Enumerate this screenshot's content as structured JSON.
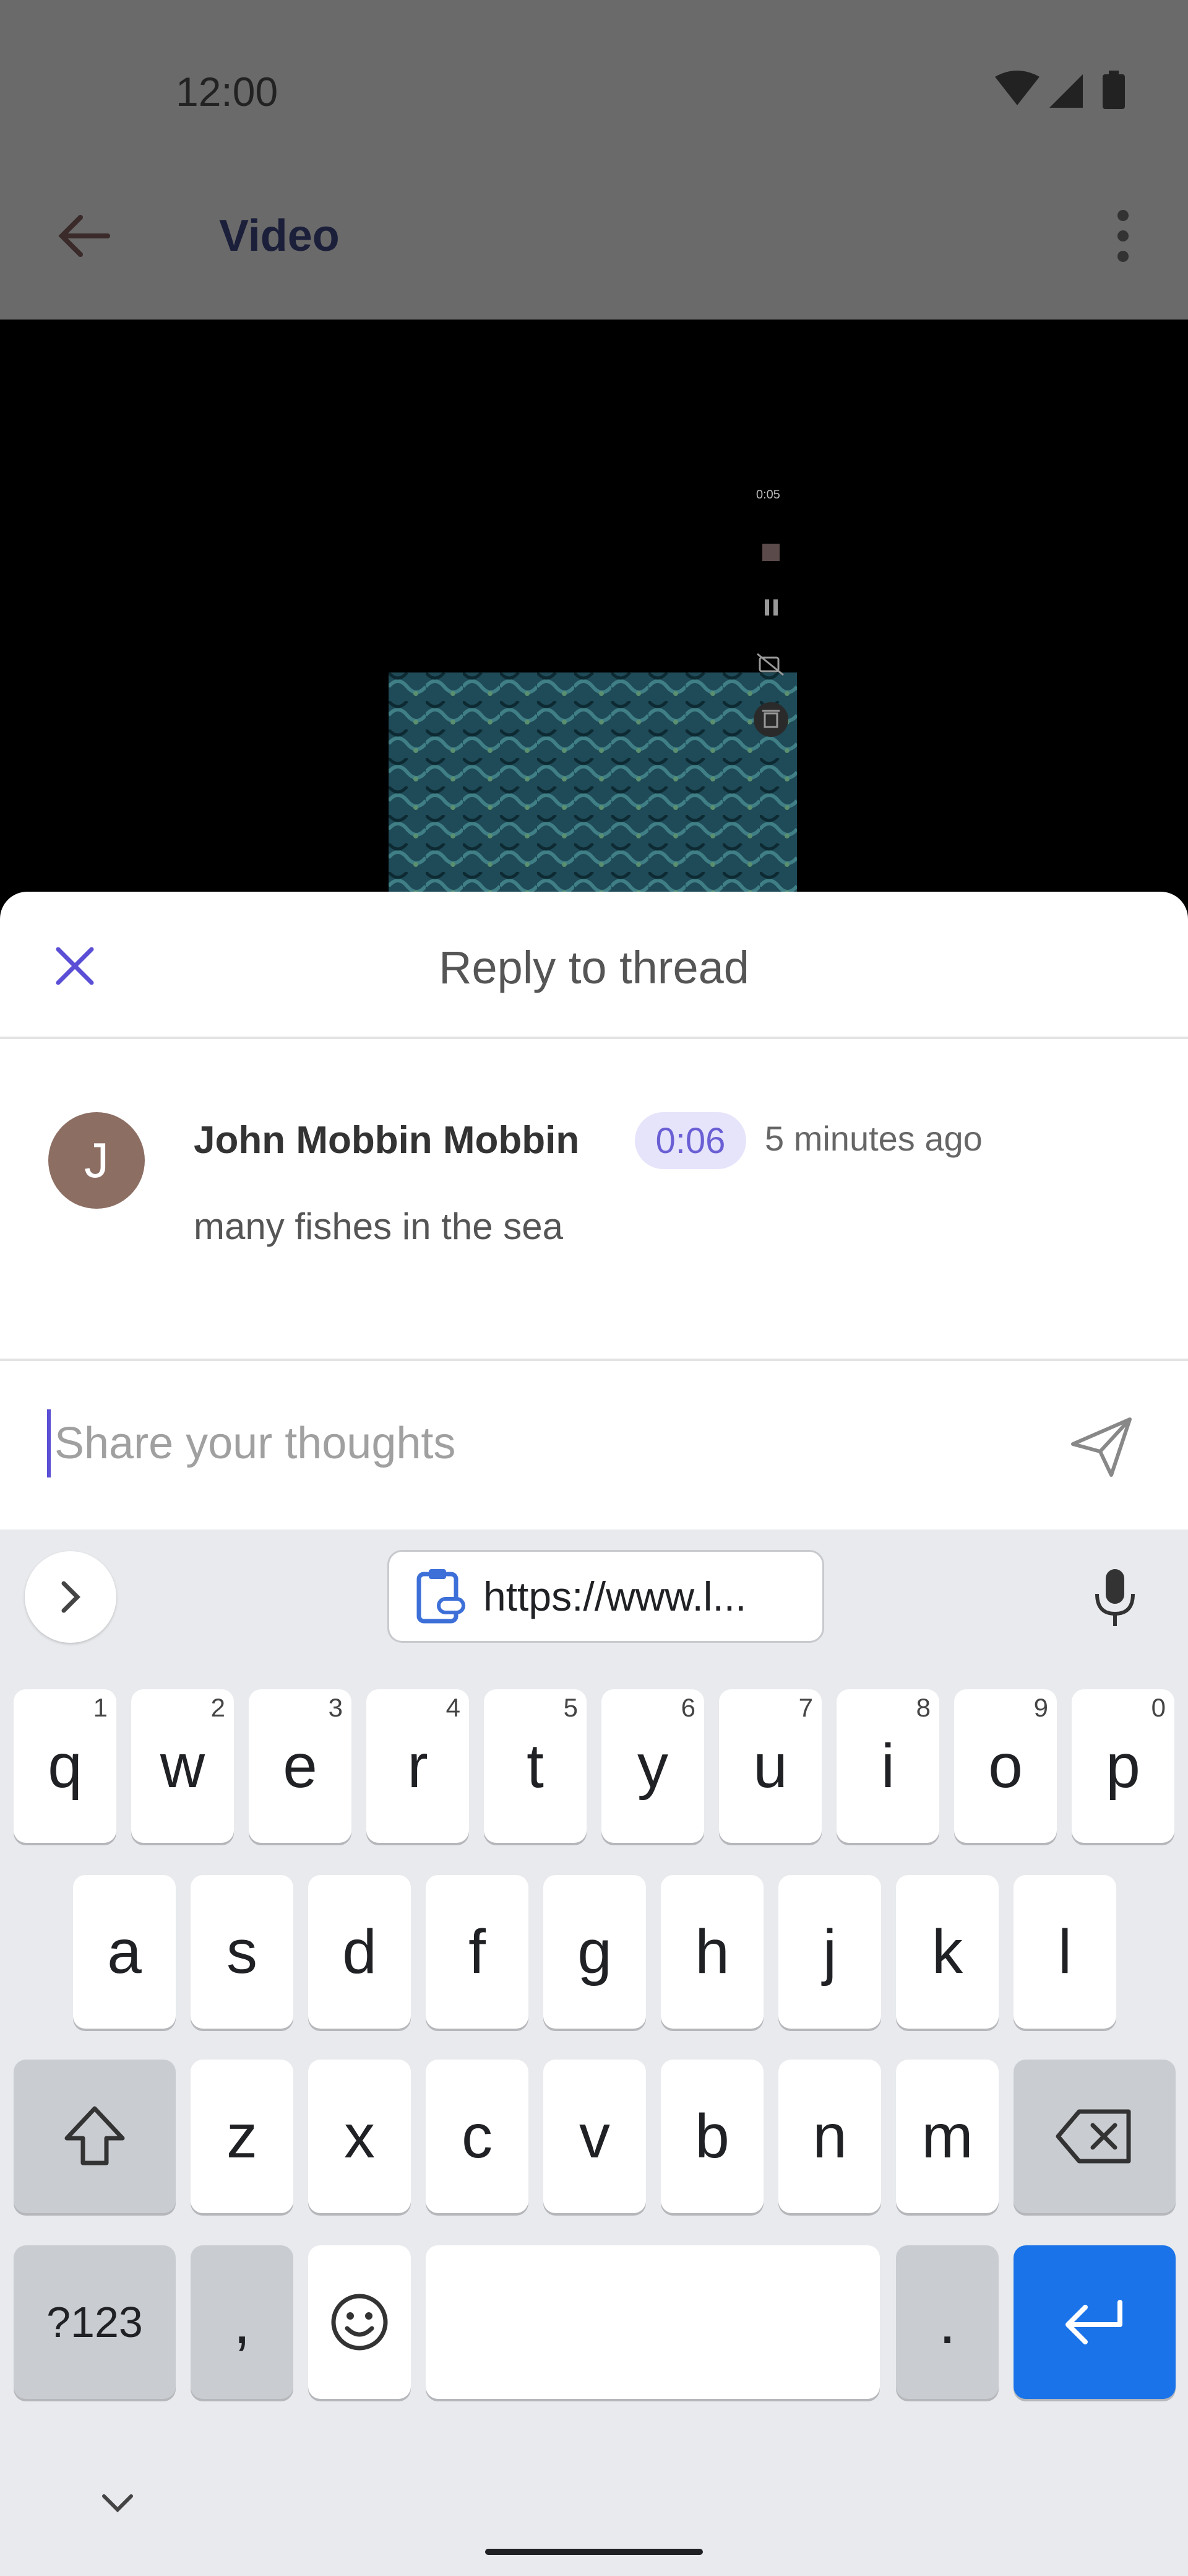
{
  "status_bar": {
    "time": "12:00"
  },
  "app_bar": {
    "title": "Video"
  },
  "video": {
    "rec_time": "0:05"
  },
  "sheet": {
    "title": "Reply to thread"
  },
  "comment": {
    "avatar_initial": "J",
    "author": "John Mobbin Mobbin",
    "timestamp": "0:06",
    "time_ago": "5 minutes ago",
    "text": "many fishes in the sea"
  },
  "composer": {
    "placeholder": "Share your thoughts"
  },
  "keyboard": {
    "clipboard_text": "https://www.l...",
    "row1": [
      {
        "label": "q",
        "hint": "1"
      },
      {
        "label": "w",
        "hint": "2"
      },
      {
        "label": "e",
        "hint": "3"
      },
      {
        "label": "r",
        "hint": "4"
      },
      {
        "label": "t",
        "hint": "5"
      },
      {
        "label": "y",
        "hint": "6"
      },
      {
        "label": "u",
        "hint": "7"
      },
      {
        "label": "i",
        "hint": "8"
      },
      {
        "label": "o",
        "hint": "9"
      },
      {
        "label": "p",
        "hint": "0"
      }
    ],
    "row2": [
      "a",
      "s",
      "d",
      "f",
      "g",
      "h",
      "j",
      "k",
      "l"
    ],
    "row3": [
      "z",
      "x",
      "c",
      "v",
      "b",
      "n",
      "m"
    ],
    "symbols_label": "?123",
    "comma_label": ",",
    "period_label": "."
  },
  "colors": {
    "accent": "#5b4fd6",
    "enter_key": "#1a73e8",
    "badge_bg": "#e6e4fb"
  },
  "icons": [
    "back-arrow-icon",
    "more-vert-icon",
    "close-icon",
    "send-icon",
    "chevron-right-icon",
    "clipboard-link-icon",
    "mic-icon",
    "shift-icon",
    "backspace-icon",
    "emoji-icon",
    "enter-icon",
    "chevron-down-icon"
  ]
}
